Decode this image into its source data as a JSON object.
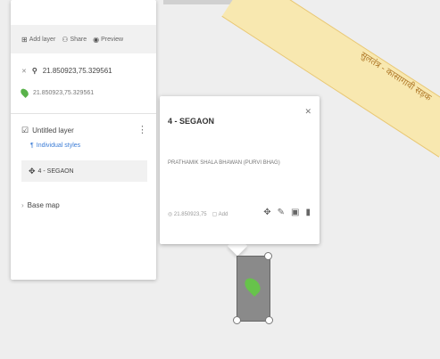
{
  "map": {
    "road_label": "सुलतंत्र - कासागावी सड़क"
  },
  "toolbar": {
    "add_layer": "Add layer",
    "share": "Share",
    "preview": "Preview"
  },
  "search": {
    "query": "21.850923,75.329561",
    "result": "21.850923,75.329561"
  },
  "layer": {
    "name": "Untitled layer",
    "styles": "Individual styles",
    "feature": "4 - SEGAON"
  },
  "basemap": {
    "label": "Base map"
  },
  "popup": {
    "title": "4 - SEGAON",
    "description": "PRATHAMIK SHALA BHAWAN (PURVI BHAG)",
    "footer_left": "21.850923,75",
    "footer_right": "Add"
  },
  "colors": {
    "accent": "#3b7cd6",
    "pin": "#67c34b",
    "road": "#f8e8b0"
  }
}
